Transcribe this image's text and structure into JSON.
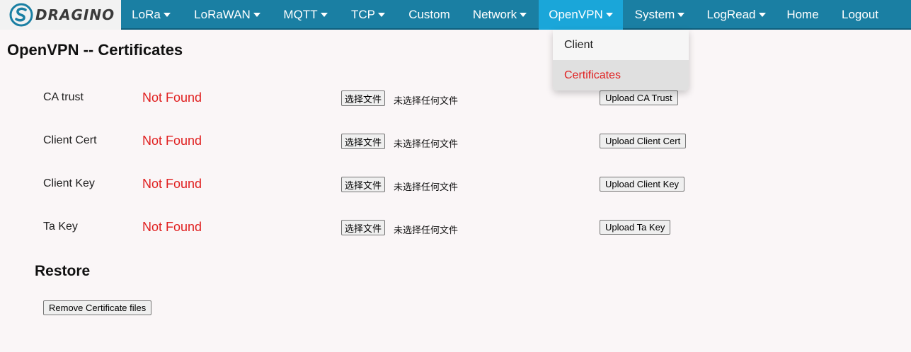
{
  "nav": {
    "logo_text": "DRAGINO",
    "items": [
      {
        "label": "LoRa",
        "dropdown": true
      },
      {
        "label": "LoRaWAN",
        "dropdown": true
      },
      {
        "label": "MQTT",
        "dropdown": true
      },
      {
        "label": "TCP",
        "dropdown": true
      },
      {
        "label": "Custom",
        "dropdown": false
      },
      {
        "label": "Network",
        "dropdown": true
      },
      {
        "label": "OpenVPN",
        "dropdown": true,
        "active": true
      },
      {
        "label": "System",
        "dropdown": true
      },
      {
        "label": "LogRead",
        "dropdown": true
      },
      {
        "label": "Home",
        "dropdown": false
      },
      {
        "label": "Logout",
        "dropdown": false
      }
    ]
  },
  "dropdown": {
    "items": [
      {
        "label": "Client"
      },
      {
        "label": "Certificates",
        "selected": true
      }
    ]
  },
  "page": {
    "title": "OpenVPN -- Certificates"
  },
  "certs": [
    {
      "label": "CA trust",
      "status": "Not Found",
      "choose_label": "选择文件",
      "file_status": "未选择任何文件",
      "upload_label": "Upload CA Trust"
    },
    {
      "label": "Client Cert",
      "status": "Not Found",
      "choose_label": "选择文件",
      "file_status": "未选择任何文件",
      "upload_label": "Upload Client Cert"
    },
    {
      "label": "Client Key",
      "status": "Not Found",
      "choose_label": "选择文件",
      "file_status": "未选择任何文件",
      "upload_label": "Upload Client Key"
    },
    {
      "label": "Ta Key",
      "status": "Not Found",
      "choose_label": "选择文件",
      "file_status": "未选择任何文件",
      "upload_label": "Upload Ta Key"
    }
  ],
  "restore": {
    "title": "Restore",
    "remove_label": "Remove Certificate files"
  },
  "colors": {
    "nav_bg": "#1a7fa3",
    "nav_active": "#1aa6d9",
    "error_red": "#e02020"
  }
}
